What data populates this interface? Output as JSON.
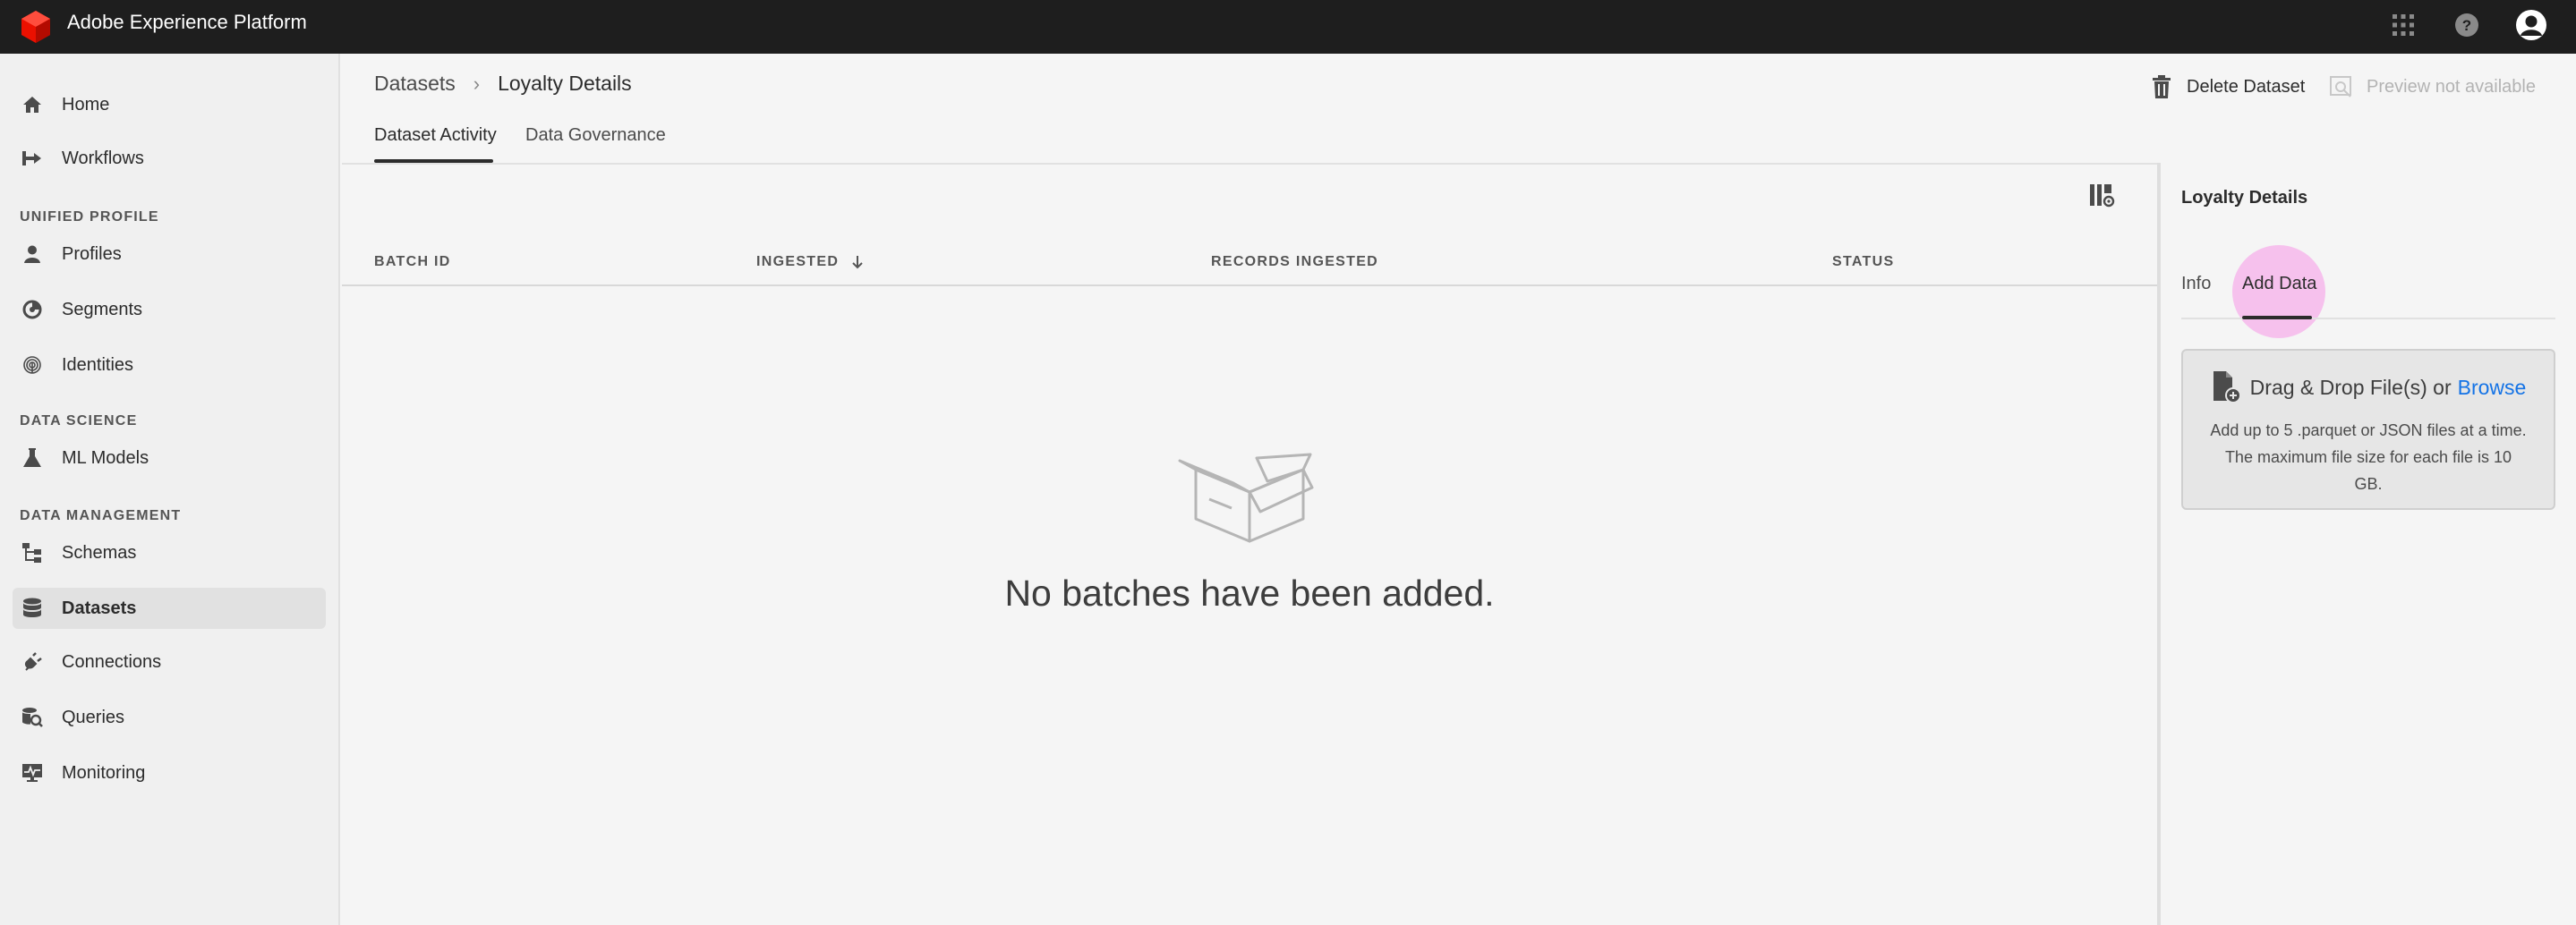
{
  "app": {
    "title": "Adobe Experience Platform"
  },
  "topbar_icons": [
    "apps-grid-icon",
    "help-icon",
    "user-avatar-icon"
  ],
  "sidebar": {
    "items": [
      {
        "label": "Home",
        "icon": "home-icon"
      },
      {
        "label": "Workflows",
        "icon": "workflow-icon"
      },
      {
        "section": "UNIFIED PROFILE"
      },
      {
        "label": "Profiles",
        "icon": "user-icon"
      },
      {
        "label": "Segments",
        "icon": "segments-icon"
      },
      {
        "label": "Identities",
        "icon": "fingerprint-icon"
      },
      {
        "section": "DATA SCIENCE"
      },
      {
        "label": "ML Models",
        "icon": "flask-icon"
      },
      {
        "section": "DATA MANAGEMENT"
      },
      {
        "label": "Schemas",
        "icon": "schema-icon"
      },
      {
        "label": "Datasets",
        "icon": "database-icon",
        "active": true
      },
      {
        "label": "Connections",
        "icon": "plug-icon"
      },
      {
        "label": "Queries",
        "icon": "query-icon"
      },
      {
        "label": "Monitoring",
        "icon": "monitor-icon"
      }
    ]
  },
  "breadcrumb": {
    "root": "Datasets",
    "current": "Loyalty Details"
  },
  "tabs": [
    {
      "label": "Dataset Activity",
      "active": true
    },
    {
      "label": "Data Governance",
      "active": false
    }
  ],
  "actions": {
    "delete": "Delete Dataset",
    "preview": "Preview not available"
  },
  "table": {
    "columns": [
      "BATCH ID",
      "INGESTED",
      "RECORDS INGESTED",
      "STATUS"
    ],
    "sorted_column": "INGESTED",
    "sort_direction": "descending",
    "rows": [],
    "empty_message": "No batches have been added."
  },
  "panel": {
    "title": "Loyalty Details",
    "tabs": [
      {
        "label": "Info",
        "active": false
      },
      {
        "label": "Add Data",
        "active": true
      }
    ],
    "dropzone": {
      "heading": "Drag & Drop File(s) or",
      "browse": "Browse",
      "description": "Add up to 5 .parquet or JSON files at a time. The maximum file size for each file is 10 GB."
    }
  },
  "colors": {
    "topbar": "#1e1e1e",
    "brand_red": "#eb1000",
    "link": "#1473e6",
    "highlight": "#f596e6"
  }
}
